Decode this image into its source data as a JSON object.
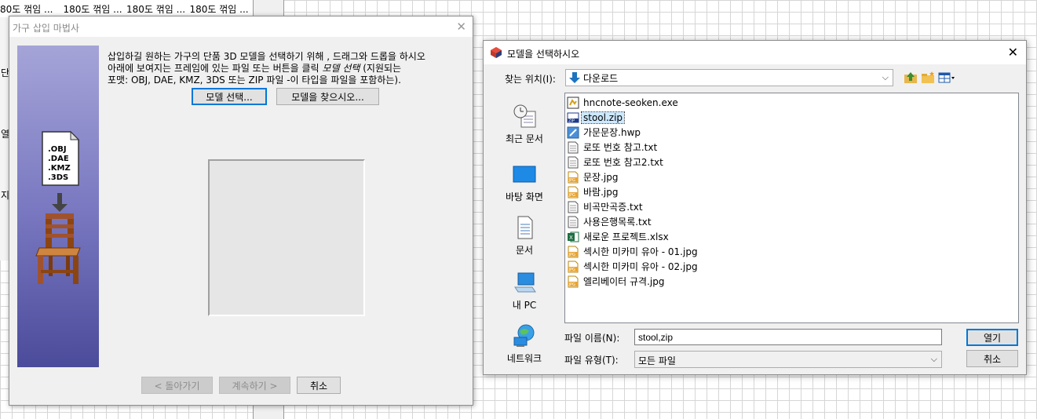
{
  "background": {
    "tabs": [
      "80도 꺾임 ...",
      "180도 꺾임 ...",
      "180도 꺾임 ...",
      "180도 꺾임 ..."
    ],
    "side_chars": [
      "단",
      "열",
      "지"
    ]
  },
  "wizard": {
    "title": "가구 삽입 마법사",
    "doc_formats": [
      ".OBJ",
      ".DAE",
      ".KMZ",
      ".3DS"
    ],
    "instructions": [
      "삽입하길 원하는 가구의 단품 3D 모델을 선택하기 위해 , 드래그와 드롭을 하시오",
      "아래에 보여지는 프레임에 있는 파일 또는 버튼을 클릭",
      "모델 선택",
      " (지원되는",
      "포맷: OBJ, DAE, KMZ, 3DS 또는 ZIP 파일 -이 타입을 파일을 포함하는)."
    ],
    "select_model_button": "모델 선택...",
    "find_model_button": "모델을 찾으시오...",
    "back_button": "< 돌아가기",
    "continue_button": "계속하기 >",
    "cancel_button": "취소"
  },
  "file_dialog": {
    "title": "모델을 선택하시오",
    "look_in_label": "찾는 위치(I):",
    "look_in_value": "다운로드",
    "places": [
      "최근 문서",
      "바탕 화면",
      "문서",
      "내 PC",
      "네트워크"
    ],
    "files": [
      {
        "name": "hncnote-seoken.exe",
        "icon": "exe-icon"
      },
      {
        "name": "stool.zip",
        "icon": "zip-icon",
        "selected": true
      },
      {
        "name": "가문문장.hwp",
        "icon": "hwp-icon"
      },
      {
        "name": "로또 번호 참고.txt",
        "icon": "txt-icon"
      },
      {
        "name": "로또 번호 참고2.txt",
        "icon": "txt-icon"
      },
      {
        "name": "문장.jpg",
        "icon": "jpg-icon"
      },
      {
        "name": "바람.jpg",
        "icon": "jpg-icon"
      },
      {
        "name": "비곡만곡증.txt",
        "icon": "txt-icon"
      },
      {
        "name": "사용은행목록.txt",
        "icon": "txt-icon"
      },
      {
        "name": "새로운 프로젝트.xlsx",
        "icon": "xlsx-icon"
      },
      {
        "name": "섹시한 미카미 유아 - 01.jpg",
        "icon": "jpg-icon"
      },
      {
        "name": "섹시한 미카미 유아 - 02.jpg",
        "icon": "jpg-icon"
      },
      {
        "name": "엘리베이터 규격.jpg",
        "icon": "jpg-icon"
      }
    ],
    "file_name_label": "파일 이름(N):",
    "file_name_value": "stool,zip",
    "file_type_label": "파일 유형(T):",
    "file_type_value": "모든 파일",
    "open_button": "열기",
    "cancel_button": "취소"
  }
}
